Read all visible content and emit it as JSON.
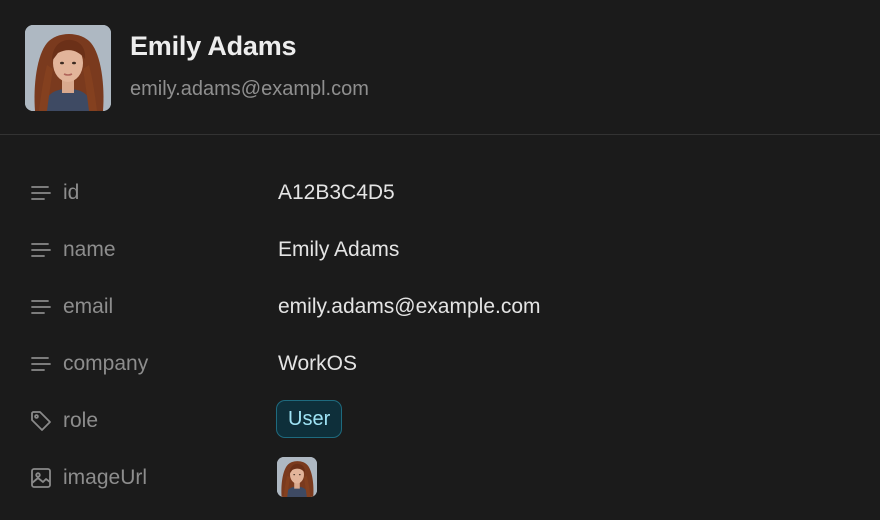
{
  "user": {
    "name": "Emily Adams",
    "email": "emily.adams@exampl.com",
    "avatar_icon": "user-photo"
  },
  "fields": [
    {
      "key": "id",
      "icon": "text-lines-icon",
      "value": "A12B3C4D5"
    },
    {
      "key": "name",
      "icon": "text-lines-icon",
      "value": "Emily Adams"
    },
    {
      "key": "email",
      "icon": "text-lines-icon",
      "value": "emily.adams@example.com"
    },
    {
      "key": "company",
      "icon": "text-lines-icon",
      "value": "WorkOS"
    },
    {
      "key": "role",
      "icon": "tag-icon",
      "value": "User"
    },
    {
      "key": "imageUrl",
      "icon": "image-icon",
      "value": ""
    }
  ],
  "colors": {
    "background": "#1b1b1b",
    "badge_bg": "#0e2f3a",
    "badge_border": "#1e6a7e",
    "badge_text": "#9fe3f4"
  }
}
